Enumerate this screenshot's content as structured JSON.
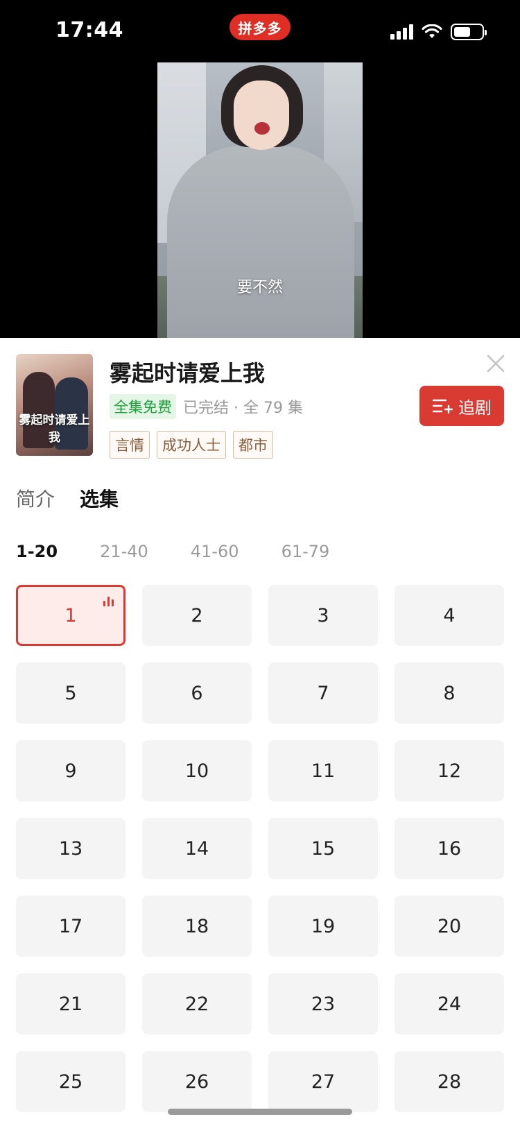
{
  "status_bar": {
    "time": "17:44",
    "app_name": "拼多多",
    "icons": [
      "signal-icon",
      "wifi-icon",
      "battery-icon"
    ]
  },
  "video": {
    "subtitle": "要不然"
  },
  "drama": {
    "poster_title": "雾起时请爱上我",
    "title": "雾起时请爱上我",
    "free_badge": "全集免费",
    "status": "已完结 · 全 79 集",
    "tags": [
      "言情",
      "成功人士",
      "都市"
    ],
    "follow_label": "追剧"
  },
  "tabs": [
    {
      "label": "简介",
      "active": false
    },
    {
      "label": "选集",
      "active": true
    }
  ],
  "ranges": [
    {
      "label": "1-20",
      "active": true
    },
    {
      "label": "21-40",
      "active": false
    },
    {
      "label": "41-60",
      "active": false
    },
    {
      "label": "61-79",
      "active": false
    }
  ],
  "episodes": [
    "1",
    "2",
    "3",
    "4",
    "5",
    "6",
    "7",
    "8",
    "9",
    "10",
    "11",
    "12",
    "13",
    "14",
    "15",
    "16",
    "17",
    "18",
    "19",
    "20",
    "21",
    "22",
    "23",
    "24",
    "25",
    "26",
    "27",
    "28"
  ],
  "current_episode": "1",
  "colors": {
    "accent": "#d93a31",
    "free_green": "#1ca23c",
    "tag_brown": "#8a5b3c",
    "app_red": "#e02e24"
  }
}
